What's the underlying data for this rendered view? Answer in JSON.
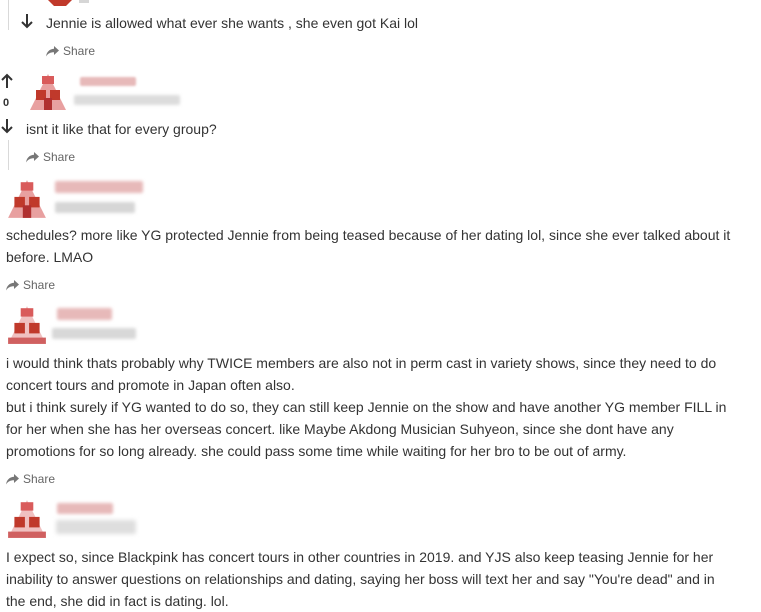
{
  "colors": {
    "text": "#333333",
    "muted": "#666666",
    "avatar_red": "#c0392b",
    "avatar_pink": "#e8a0a0",
    "username_blur": "#e7b9b9",
    "meta_blur": "#d6d6d6"
  },
  "comments": [
    {
      "text_lines": [
        "Jennie is allowed what ever she wants , she even got Kai lol"
      ],
      "share_label": "Share",
      "icon": "share-icon"
    },
    {
      "vote_count": "0",
      "text_lines": [
        "isnt it like that for every group?"
      ],
      "share_label": "Share",
      "icon": "share-icon"
    },
    {
      "text_lines": [
        "schedules? more like YG protected Jennie from being teased because of her dating lol, since she ever talked about it",
        "before. LMAO"
      ],
      "share_label": "Share",
      "icon": "share-icon"
    },
    {
      "text_lines": [
        "i would think thats probably why TWICE members are also not in perm cast in variety shows, since they need to do",
        "concert tours and promote in Japan often also.",
        "but i think surely if YG wanted to do so, they can still keep Jennie on the show and have another YG member FILL in",
        "for her when she has her overseas concert. like Maybe Akdong Musician Suhyeon, since she dont have any",
        "promotions for so long already. she could pass some time while waiting for her bro to be out of army."
      ],
      "share_label": "Share",
      "icon": "share-icon"
    },
    {
      "text_lines": [
        "I expect so, since Blackpink has concert tours in other countries in 2019. and YJS also keep teasing Jennie for her",
        "inability to answer questions on relationships and dating, saying her boss will text her and say \"You're dead\" and in",
        "the end, she did in fact is dating. lol."
      ]
    }
  ]
}
